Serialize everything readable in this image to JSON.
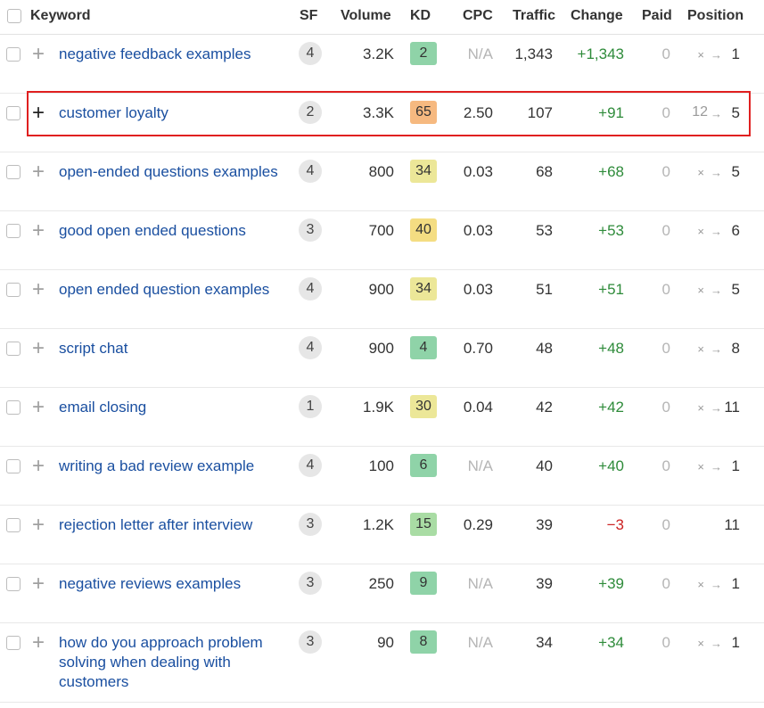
{
  "header": {
    "keyword": "Keyword",
    "sf": "SF",
    "volume": "Volume",
    "kd": "KD",
    "cpc": "CPC",
    "traffic": "Traffic",
    "change": "Change",
    "paid": "Paid",
    "position": "Position"
  },
  "icons": {
    "plus": "plus-icon",
    "arrow": "arrow-right-icon",
    "cross": "cross-icon"
  },
  "colors": {
    "kw_link": "#1a4fa0",
    "positive": "#2e8b3a",
    "negative": "#cc2222",
    "highlight_border": "#e02020"
  },
  "rows": [
    {
      "keyword": "negative feedback examples",
      "sf": "4",
      "volume": "3.2K",
      "kd": "2",
      "kd_color": "#8fd3a8",
      "cpc": "N/A",
      "traffic": "1,343",
      "change": "+1,343",
      "change_type": "positive",
      "paid": "0",
      "pos_prev": "×",
      "pos": "1"
    },
    {
      "keyword": "customer loyalty",
      "sf": "2",
      "volume": "3.3K",
      "kd": "65",
      "kd_color": "#f6b980",
      "cpc": "2.50",
      "traffic": "107",
      "change": "+91",
      "change_type": "positive",
      "paid": "0",
      "pos_prev": "12",
      "pos": "5"
    },
    {
      "keyword": "open-ended questions examples",
      "sf": "4",
      "volume": "800",
      "kd": "34",
      "kd_color": "#ece798",
      "cpc": "0.03",
      "traffic": "68",
      "change": "+68",
      "change_type": "positive",
      "paid": "0",
      "pos_prev": "×",
      "pos": "5"
    },
    {
      "keyword": "good open ended questions",
      "sf": "3",
      "volume": "700",
      "kd": "40",
      "kd_color": "#f4dd82",
      "cpc": "0.03",
      "traffic": "53",
      "change": "+53",
      "change_type": "positive",
      "paid": "0",
      "pos_prev": "×",
      "pos": "6"
    },
    {
      "keyword": "open ended question examples",
      "sf": "4",
      "volume": "900",
      "kd": "34",
      "kd_color": "#ece798",
      "cpc": "0.03",
      "traffic": "51",
      "change": "+51",
      "change_type": "positive",
      "paid": "0",
      "pos_prev": "×",
      "pos": "5"
    },
    {
      "keyword": "script chat",
      "sf": "4",
      "volume": "900",
      "kd": "4",
      "kd_color": "#8fd3a8",
      "cpc": "0.70",
      "traffic": "48",
      "change": "+48",
      "change_type": "positive",
      "paid": "0",
      "pos_prev": "×",
      "pos": "8"
    },
    {
      "keyword": "email closing",
      "sf": "1",
      "volume": "1.9K",
      "kd": "30",
      "kd_color": "#ece798",
      "cpc": "0.04",
      "traffic": "42",
      "change": "+42",
      "change_type": "positive",
      "paid": "0",
      "pos_prev": "×",
      "pos": "11"
    },
    {
      "keyword": "writing a bad review example",
      "sf": "4",
      "volume": "100",
      "kd": "6",
      "kd_color": "#8fd3a8",
      "cpc": "N/A",
      "traffic": "40",
      "change": "+40",
      "change_type": "positive",
      "paid": "0",
      "pos_prev": "×",
      "pos": "1"
    },
    {
      "keyword": "rejection letter after interview",
      "sf": "3",
      "volume": "1.2K",
      "kd": "15",
      "kd_color": "#a9dca4",
      "cpc": "0.29",
      "traffic": "39",
      "change": "−3",
      "change_type": "negative",
      "paid": "0",
      "pos_prev": "",
      "pos": "11"
    },
    {
      "keyword": "negative reviews examples",
      "sf": "3",
      "volume": "250",
      "kd": "9",
      "kd_color": "#8fd3a8",
      "cpc": "N/A",
      "traffic": "39",
      "change": "+39",
      "change_type": "positive",
      "paid": "0",
      "pos_prev": "×",
      "pos": "1"
    },
    {
      "keyword": "how do you approach problem solving when dealing with customers",
      "sf": "3",
      "volume": "90",
      "kd": "8",
      "kd_color": "#8fd3a8",
      "cpc": "N/A",
      "traffic": "34",
      "change": "+34",
      "change_type": "positive",
      "paid": "0",
      "pos_prev": "×",
      "pos": "1"
    }
  ]
}
